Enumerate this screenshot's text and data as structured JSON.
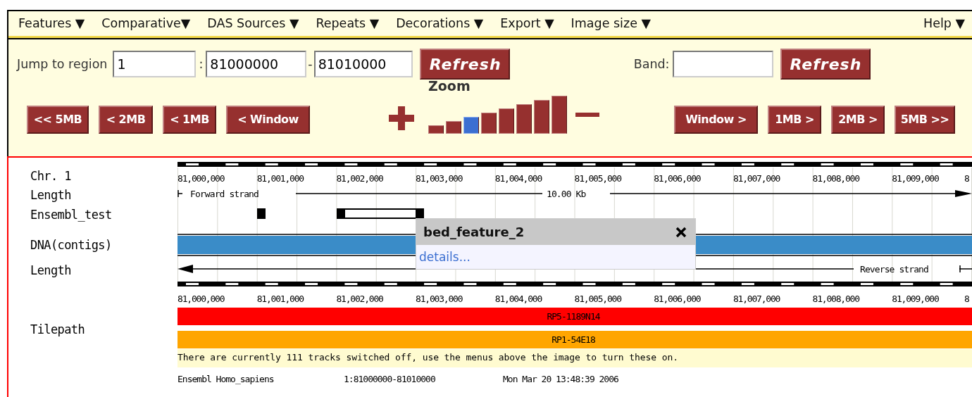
{
  "menu": [
    {
      "label": "Features ▼"
    },
    {
      "label": "Comparative▼"
    },
    {
      "label": "DAS Sources ▼"
    },
    {
      "label": "Repeats ▼"
    },
    {
      "label": "Decorations ▼"
    },
    {
      "label": "Export ▼"
    },
    {
      "label": "Image size ▼"
    },
    {
      "label": "Help ▼"
    }
  ],
  "jump": {
    "label": "Jump to region",
    "chromosome": "1",
    "separator_1": ":",
    "start": "81000000",
    "separator_2": "-",
    "end": "81010000",
    "button": "Refresh"
  },
  "band": {
    "label": "Band:",
    "button": "Refresh"
  },
  "nav_left": [
    "<< 5MB",
    "< 2MB",
    "< 1MB",
    "< Window"
  ],
  "zoom": {
    "label": "Zoom",
    "levels": [
      {
        "selected": false
      },
      {
        "selected": false
      },
      {
        "selected": true
      },
      {
        "selected": false
      },
      {
        "selected": false
      },
      {
        "selected": false
      },
      {
        "selected": false
      },
      {
        "selected": false
      }
    ]
  },
  "nav_right": [
    "Window >",
    "1MB >",
    "2MB >",
    "5MB >>"
  ],
  "tracks": {
    "labels": [
      "Chr. 1",
      "Length",
      "Ensembl_test",
      "DNA(contigs)",
      "Length",
      "Tilepath"
    ],
    "top_ruler_ticks": [
      "81,000,000",
      "81,001,000",
      "81,002,000",
      "81,003,000",
      "81,004,000",
      "81,005,000",
      "81,006,000",
      "81,007,000",
      "81,008,000",
      "81,009,000",
      "8"
    ],
    "bottom_ruler_ticks": [
      "81,000,000",
      "81,001,000",
      "81,002,000",
      "81,003,000",
      "81,004,000",
      "81,005,000",
      "81,006,000",
      "81,007,000",
      "81,008,000",
      "81,009,000",
      "8"
    ],
    "forward_strand": "Forward strand",
    "length": "10.00 Kb",
    "reverse_strand": "Reverse strand",
    "clones": [
      {
        "name": "RP5-1189N14",
        "color": "#ff0000"
      },
      {
        "name": "RP1-54E18",
        "color": "#ffa500"
      }
    ],
    "notice": "There are currently 111 tracks switched off, use the menus above the image to turn these on.",
    "footer": [
      "Ensembl Homo_sapiens",
      "1:81000000-81010000",
      "Mon Mar 20 13:48:39 2006"
    ]
  },
  "popup": {
    "title": "bed_feature_2",
    "link": "details..."
  }
}
